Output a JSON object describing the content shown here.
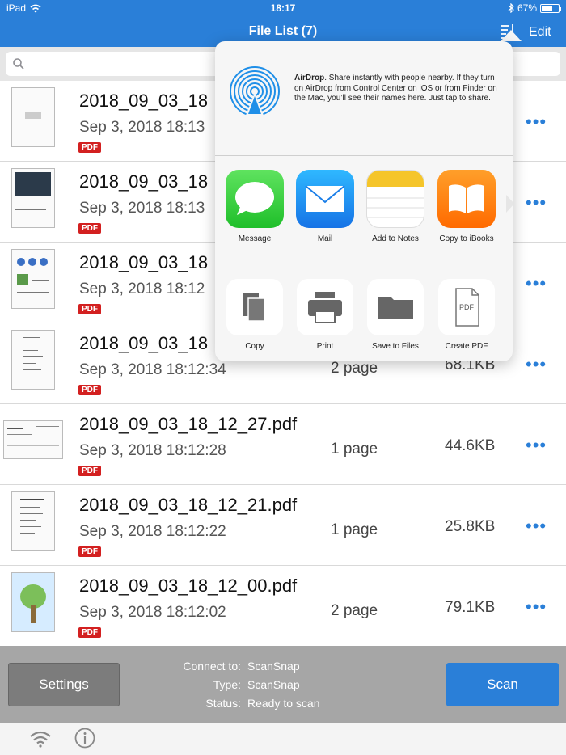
{
  "status_bar": {
    "device": "iPad",
    "time": "18:17",
    "battery": "67%"
  },
  "nav": {
    "title": "File List (7)",
    "edit": "Edit"
  },
  "files": [
    {
      "name": "2018_09_03_18",
      "date": "Sep 3, 2018 18:13",
      "badge": "PDF",
      "pages": "",
      "size": ""
    },
    {
      "name": "2018_09_03_18",
      "date": "Sep 3, 2018 18:13",
      "badge": "PDF",
      "pages": "",
      "size": ""
    },
    {
      "name": "2018_09_03_18",
      "date": "Sep 3, 2018 18:12",
      "badge": "PDF",
      "pages": "",
      "size": ""
    },
    {
      "name": "2018_09_03_18",
      "date": "Sep 3, 2018 18:12:34",
      "badge": "PDF",
      "pages": "2 page",
      "size": "68.1KB"
    },
    {
      "name": "2018_09_03_18_12_27.pdf",
      "date": "Sep 3, 2018 18:12:28",
      "badge": "PDF",
      "pages": "1 page",
      "size": "44.6KB"
    },
    {
      "name": "2018_09_03_18_12_21.pdf",
      "date": "Sep 3, 2018 18:12:22",
      "badge": "PDF",
      "pages": "1 page",
      "size": "25.8KB"
    },
    {
      "name": "2018_09_03_18_12_00.pdf",
      "date": "Sep 3, 2018 18:12:02",
      "badge": "PDF",
      "pages": "2 page",
      "size": "79.1KB"
    }
  ],
  "more_glyph": "•••",
  "share": {
    "airdrop_title": "AirDrop",
    "airdrop_text": ". Share instantly with people nearby. If they turn on AirDrop from Control Center on iOS or from Finder on the Mac, you’ll see their names here. Just tap to share.",
    "apps": [
      "Message",
      "Mail",
      "Add to Notes",
      "Copy to iBooks"
    ],
    "actions": [
      "Copy",
      "Print",
      "Save to Files",
      "Create PDF"
    ],
    "pdf_label": "PDF"
  },
  "bottom": {
    "settings": "Settings",
    "scan": "Scan",
    "connect_label": "Connect to:",
    "connect_value": "ScanSnap",
    "type_label": "Type:",
    "type_value": "ScanSnap",
    "status_label": "Status:",
    "status_value": "Ready to scan"
  },
  "colors": {
    "accent": "#2a7fd8",
    "pdf_badge": "#d32020",
    "bottom_bar": "#a6a6a6"
  }
}
